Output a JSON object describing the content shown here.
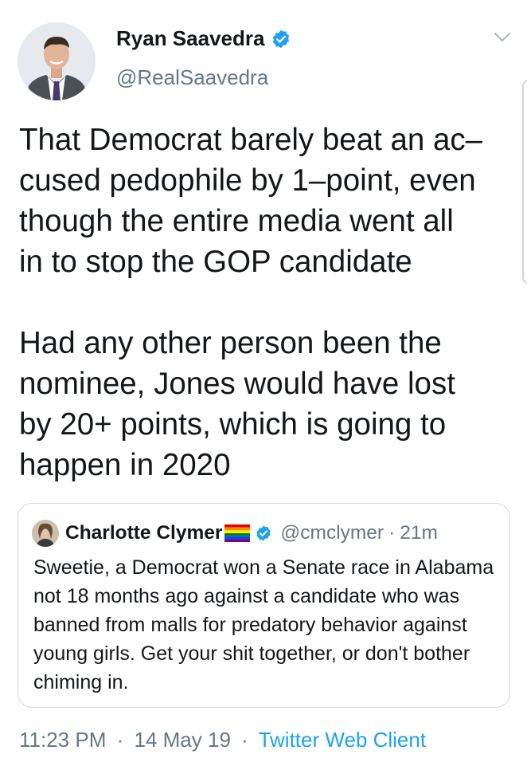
{
  "author": {
    "name": "Ryan Saavedra",
    "handle": "@RealSaavedra",
    "verified": true
  },
  "tweet": {
    "text": "That Democrat barely beat an ac–\ncused pedophile by 1–point, even\nthough the entire media went all\nin to stop the GOP candidate\n\nHad any other person been the\nnominee, Jones would have lost\nby 20+ points, which is going to\nhappen in 2020"
  },
  "quoted_tweet": {
    "name": "Charlotte Clymer",
    "flag_icon": "rainbow-flag-icon",
    "verified": true,
    "handle": "@cmclymer",
    "separator": "·",
    "time": "21m",
    "text": "Sweetie, a Democrat won a Senate race in Alabama not 18 months ago against a candidate who was banned from malls for predatory behavior against young girls. Get your shit together, or don't bother chiming in."
  },
  "meta": {
    "time": "11:23 PM",
    "separator": "·",
    "date": "14 May 19",
    "client": "Twitter Web Client"
  },
  "colors": {
    "accent": "#1da1f2",
    "secondary_text": "#657786",
    "primary_text": "#14171a",
    "border": "#cfd9de"
  },
  "icons": [
    "verified-badge-icon",
    "chevron-down-icon",
    "rainbow-flag-icon"
  ]
}
